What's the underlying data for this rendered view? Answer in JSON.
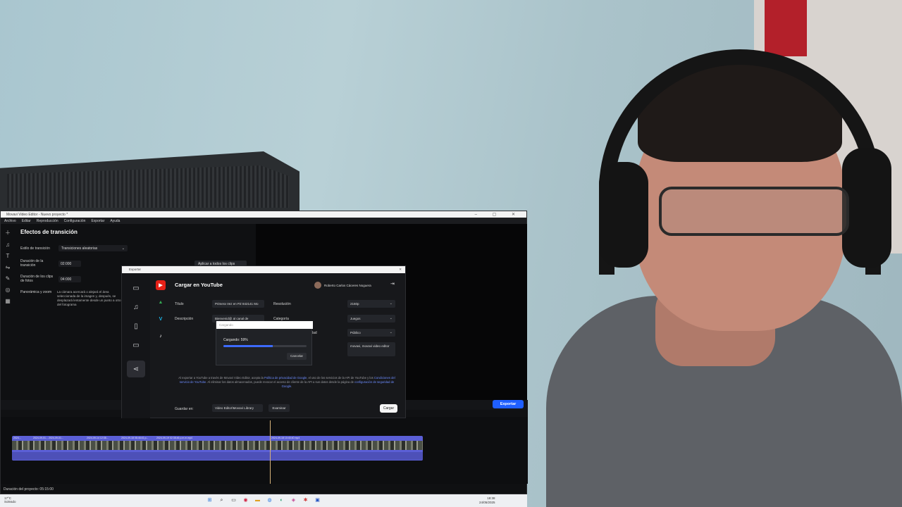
{
  "editor": {
    "window_title": "Movavi Video Editor - Nuevo proyecto *",
    "menu": [
      "Archivo",
      "Editar",
      "Reproducción",
      "Configuración",
      "Exportar",
      "Ayuda"
    ],
    "panel_title": "Efectos de transición",
    "transition_style_label": "Estilo de transición",
    "transition_style_value": "Transiciones aleatorias",
    "transition_duration_label": "Duración de la transición",
    "transition_duration_value": "02:000",
    "photo_duration_label": "Duración de los clips de fotos",
    "photo_duration_value": "04:000",
    "pan_zoom_label": "Panorámica y zoom",
    "pan_zoom_description": "La cámara acercará o alejará el área seleccionada de la imagen y, después, se desplazará lentamente desde un punto a otro del fotograma",
    "apply_all_label": "Aplicar a todos los clips",
    "export_button": "Exportar",
    "project_duration": "Duración del proyecto: 05:15:00",
    "clip_labels": [
      "2024...",
      "2024-09-01...",
      "2024-09-01...",
      "2024-09-14 12:38...",
      "2024-09-18 08:46:41 p...",
      "2024-09-19 02:38:46 p.m.m.mp4",
      "2024-09-18 10:40:40 mp4"
    ]
  },
  "dialog": {
    "window_title": "Exportar",
    "heading": "Cargar en YouTube",
    "user_name": "Roberto Carlos Cáceres Noguera",
    "title_label": "Título",
    "title_value": "Primera Vez en PZ 842141 Mo",
    "description_label": "Descripción",
    "description_value": "Bienvenid@ al canal de",
    "resolution_label": "Resolución",
    "resolution_value": "2160p",
    "category_label": "Categoría",
    "category_value": "Juegos",
    "privacy_value": "Público",
    "privacy_label_tail": "lad",
    "tags_value": "movavi, movavi video editor",
    "loading_placeholder": "Cargando",
    "loading_text": "Cargando: 59%",
    "progress_percent": 59,
    "cancel_label": "Cancelar",
    "legal_text_1": "Al exportar a YouTube a través de Movavi Video Editor, acepta la ",
    "legal_link_1": "Política de privacidad de Google",
    "legal_text_2": ", el uso de los servicios de la API de YouTube y los ",
    "legal_link_2": "Condiciones del servicio de YouTube",
    "legal_text_3": ". Al eliminar los datos almacenados, puede revocar el acceso de cliente de la API a sus datos desde la página de ",
    "legal_link_3": "configuración de seguridad de Google",
    "legal_text_4": ".",
    "save_to_label": "Guardar en:",
    "save_to_value": "Video Editor\\Movavi Library",
    "browse_label": "Examinar",
    "upload_label": "Cargar"
  },
  "taskbar": {
    "weather_temp": "17°C",
    "weather_desc": "Soleado",
    "time": "18:38",
    "date": "24/05/2025"
  },
  "colors": {
    "accent_blue": "#1f5fff",
    "youtube_red": "#e62117",
    "clip_purple": "#5b5fd6"
  }
}
